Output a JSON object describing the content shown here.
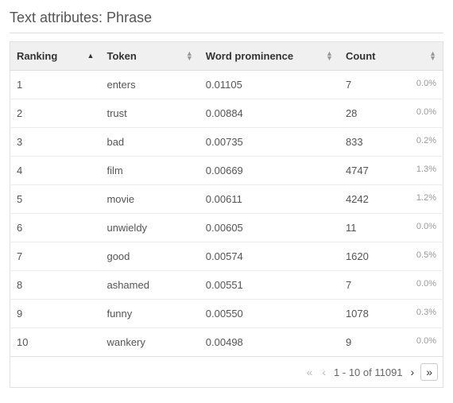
{
  "title": "Text attributes: Phrase",
  "columns": {
    "ranking": "Ranking",
    "token": "Token",
    "prominence": "Word prominence",
    "count": "Count"
  },
  "rows": [
    {
      "rank": "1",
      "token": "enters",
      "prominence": "0.01105",
      "count": "7",
      "pct": "0.0%"
    },
    {
      "rank": "2",
      "token": "trust",
      "prominence": "0.00884",
      "count": "28",
      "pct": "0.0%"
    },
    {
      "rank": "3",
      "token": "bad",
      "prominence": "0.00735",
      "count": "833",
      "pct": "0.2%"
    },
    {
      "rank": "4",
      "token": "film",
      "prominence": "0.00669",
      "count": "4747",
      "pct": "1.3%"
    },
    {
      "rank": "5",
      "token": "movie",
      "prominence": "0.00611",
      "count": "4242",
      "pct": "1.2%"
    },
    {
      "rank": "6",
      "token": "unwieldy",
      "prominence": "0.00605",
      "count": "11",
      "pct": "0.0%"
    },
    {
      "rank": "7",
      "token": "good",
      "prominence": "0.00574",
      "count": "1620",
      "pct": "0.5%"
    },
    {
      "rank": "8",
      "token": "ashamed",
      "prominence": "0.00551",
      "count": "7",
      "pct": "0.0%"
    },
    {
      "rank": "9",
      "token": "funny",
      "prominence": "0.00550",
      "count": "1078",
      "pct": "0.3%"
    },
    {
      "rank": "10",
      "token": "wankery",
      "prominence": "0.00498",
      "count": "9",
      "pct": "0.0%"
    }
  ],
  "pager": {
    "range": "1 - 10 of 11091"
  }
}
